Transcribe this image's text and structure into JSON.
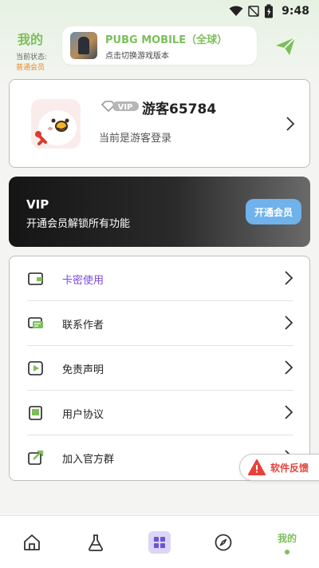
{
  "status_bar": {
    "time": "9:48"
  },
  "header": {
    "title": "我的",
    "state_label": "当前状态:",
    "state_value": "普通会员",
    "game_name": "PUBG MOBILE（全球）",
    "game_subtitle": "点击切换游戏版本"
  },
  "profile": {
    "vip_badge": "VIP",
    "name": "游客65784",
    "login_state": "当前是游客登录"
  },
  "vip_banner": {
    "title": "VIP",
    "description": "开通会员解锁所有功能",
    "button_label": "开通会员"
  },
  "menu": {
    "items": [
      {
        "label": "卡密使用",
        "icon": "wallet-icon",
        "active": true
      },
      {
        "label": "联系作者",
        "icon": "chat-icon"
      },
      {
        "label": "免责声明",
        "icon": "play-icon"
      },
      {
        "label": "用户协议",
        "icon": "book-icon"
      },
      {
        "label": "加入官方群",
        "icon": "share-icon"
      }
    ]
  },
  "feedback": {
    "label": "软件反馈"
  },
  "bottom_nav": {
    "items": [
      {
        "icon": "home-icon"
      },
      {
        "icon": "flask-icon"
      },
      {
        "icon": "apps-icon"
      },
      {
        "icon": "compass-icon"
      },
      {
        "label": "我的"
      }
    ]
  },
  "colors": {
    "brand_green": "#7cbf5a",
    "accent_purple": "#7a4ae0",
    "vip_button": "#6fb2ec",
    "feedback_red": "#e8403a",
    "member_orange": "#e68a2e"
  }
}
